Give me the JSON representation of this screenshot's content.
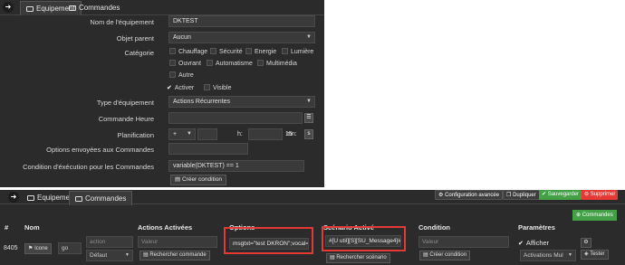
{
  "top": {
    "tabs": [
      {
        "label": "Equipement",
        "icon": "wrench-icon"
      },
      {
        "label": "Commandes",
        "icon": "list-icon"
      }
    ],
    "fields": {
      "name_label": "Nom de l'équipement",
      "name_value": "DKTEST",
      "parent_label": "Objet parent",
      "parent_value": "Aucun",
      "category_label": "Catégorie",
      "categories": [
        "Chauffage",
        "Sécurité",
        "Energie",
        "Lumière",
        "Ouvrant",
        "Automatisme",
        "Multimédia",
        "Autre"
      ],
      "activate_label": "Activer",
      "visible_label": "Visible",
      "type_label": "Type d'équipement",
      "type_value": "Actions Récurrentes",
      "cmd_time_label": "Commande Heure",
      "plan_label": "Planification",
      "plan_plus": "+",
      "plan_h": "h:",
      "plan_mn": "mn:",
      "plan_mn_value": "15",
      "plan_s": "s",
      "options_label": "Options envoyées aux Commandes",
      "condition_label": "Condition d'éxécution pour les Commandes",
      "condition_value": "variable(DKTEST) == 1",
      "create_condition": "Créer condition"
    }
  },
  "bottom": {
    "tabs": [
      {
        "label": "Equipement"
      },
      {
        "label": "Commandes"
      }
    ],
    "buttons": {
      "config": "Configuration avancée",
      "duplicate": "Dupliquer",
      "save": "Sauvegarder",
      "delete": "Supprimer",
      "commands": "Commandes"
    },
    "headers": [
      "#",
      "Nom",
      "Actions Activées",
      "Options",
      "Scénario Activé",
      "Condition",
      "Paramètres"
    ],
    "row": {
      "id": "8405",
      "icon_label": "Icone",
      "name": "go",
      "action_placeholder": "action",
      "default_value": "Défaut",
      "valeur_placeholder": "Valeur",
      "search_command": "Rechercher commande",
      "options_value": "msgtxt=\"test DKRON\";vocal=1",
      "scenario_value": "#[U util][S][SU_Message4]#",
      "search_scenario": "Rechercher scénario",
      "condition_placeholder": "Valeur",
      "create_condition": "Créer condition",
      "show_label": "Afficher",
      "activations_value": "Activations Mul",
      "test_button": "Tester"
    }
  },
  "colors": {
    "dark_bg": "#2b2b2b",
    "field_bg": "#3a3a3a",
    "highlight": "#e53935",
    "green": "#43a047",
    "red": "#e53935"
  }
}
